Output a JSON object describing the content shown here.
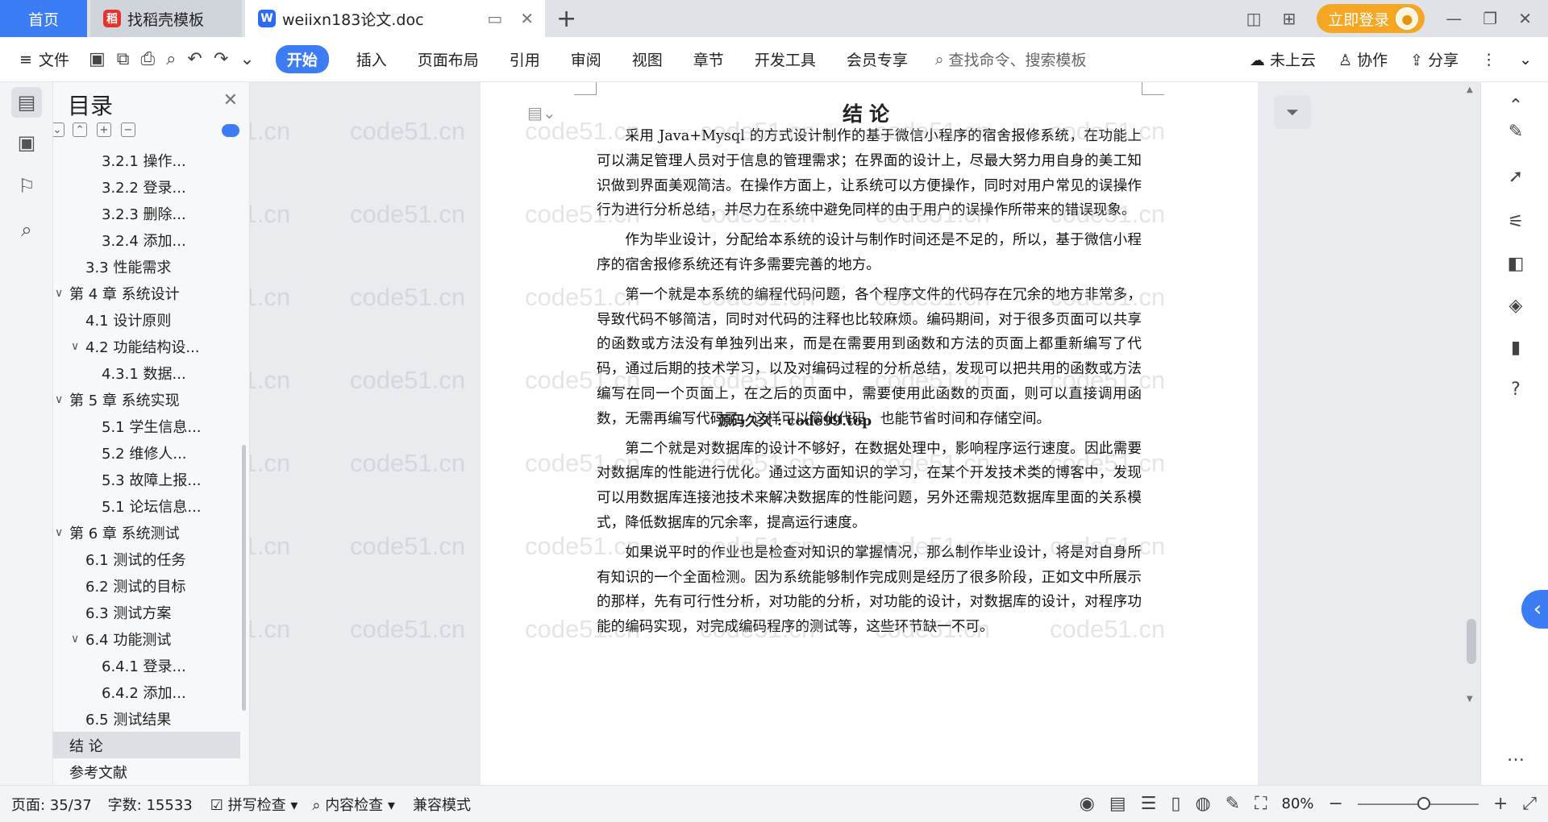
{
  "tabs": {
    "home": "首页",
    "template": "找稻壳模板",
    "doc": "weiixn183论文.doc",
    "new_tab": "+"
  },
  "window": {
    "login": "立即登录"
  },
  "toolbar": {
    "file": "文件",
    "items": [
      "开始",
      "插入",
      "页面布局",
      "引用",
      "审阅",
      "视图",
      "章节",
      "开发工具",
      "会员专享"
    ],
    "search": "查找命令、搜索模板",
    "cloud": "未上云",
    "collab": "协作",
    "share": "分享"
  },
  "toc": {
    "title": "目录",
    "items": [
      {
        "label": "3.2.1 操作...",
        "level": 3,
        "arrow": ""
      },
      {
        "label": "3.2.2 登录...",
        "level": 3,
        "arrow": ""
      },
      {
        "label": "3.2.3 删除...",
        "level": 3,
        "arrow": ""
      },
      {
        "label": "3.2.4 添加...",
        "level": 3,
        "arrow": ""
      },
      {
        "label": "3.3 性能需求",
        "level": 2,
        "arrow": ""
      },
      {
        "label": "第 4 章 系统设计",
        "level": 1,
        "arrow": "∨"
      },
      {
        "label": "4.1 设计原则",
        "level": 2,
        "arrow": ""
      },
      {
        "label": "4.2 功能结构设...",
        "level": 2,
        "arrow": "∨"
      },
      {
        "label": "4.3.1 数据...",
        "level": 3,
        "arrow": ""
      },
      {
        "label": "第 5 章 系统实现",
        "level": 1,
        "arrow": "∨"
      },
      {
        "label": "5.1 学生信息...",
        "level": 3,
        "arrow": ""
      },
      {
        "label": "5.2 维修人...",
        "level": 3,
        "arrow": ""
      },
      {
        "label": "5.3 故障上报...",
        "level": 3,
        "arrow": ""
      },
      {
        "label": "5.1 论坛信息...",
        "level": 3,
        "arrow": ""
      },
      {
        "label": "第 6 章 系统测试",
        "level": 1,
        "arrow": "∨"
      },
      {
        "label": "6.1 测试的任务",
        "level": 2,
        "arrow": ""
      },
      {
        "label": "6.2 测试的目标",
        "level": 2,
        "arrow": ""
      },
      {
        "label": "6.3 测试方案",
        "level": 2,
        "arrow": ""
      },
      {
        "label": "6.4 功能测试",
        "level": 2,
        "arrow": "∨"
      },
      {
        "label": "6.4.1 登录...",
        "level": 3,
        "arrow": ""
      },
      {
        "label": "6.4.2 添加...",
        "level": 3,
        "arrow": ""
      },
      {
        "label": "6.5 测试结果",
        "level": 2,
        "arrow": ""
      },
      {
        "label": "结 论",
        "level": 1,
        "arrow": "",
        "selected": true
      },
      {
        "label": "参考文献",
        "level": 1,
        "arrow": ""
      }
    ]
  },
  "document": {
    "heading": "结论",
    "paragraphs": [
      "采用 Java+Mysql 的方式设计制作的基于微信小程序的宿舍报修系统，在功能上可以满足管理人员对于信息的管理需求；在界面的设计上，尽最大努力用自身的美工知识做到界面美观简洁。在操作方面上，让系统可以方便操作，同时对用户常见的误操作行为进行分析总结，并尽力在系统中避免同样的由于用户的误操作所带来的错误现象。",
      "作为毕业设计，分配给本系统的设计与制作时间还是不足的，所以，基于微信小程序的宿舍报修系统还有许多需要完善的地方。",
      "第一个就是本系统的编程代码问题，各个程序文件的代码存在冗余的地方非常多，导致代码不够简洁，同时对代码的注释也比较麻烦。编码期间，对于很多页面可以共享的函数或方法没有单独列出来，而是在需要用到函数和方法的页面上都重新编写了代码，通过后期的技术学习，以及对编码过程的分析总结，发现可以把共用的函数或方法编写在同一个页面上，在之后的页面中，需要使用此函数的页面，则可以直接调用函数，无需再编写代码了，这样可以简化代码，也能节省时间和存储空间。",
      "第二个就是对数据库的设计不够好，在数据处理中，影响程序运行速度。因此需要对数据库的性能进行优化。通过这方面知识的学习，在某个开发技术类的博客中，发现可以用数据库连接池技术来解决数据库的性能问题，另外还需规范数据库里面的关系模式，降低数据库的冗余率，提高运行速度。",
      "如果说平时的作业也是检查对知识的掌握情况，那么制作毕业设计，将是对自身所有知识的一个全面检测。因为系统能够制作完成则是经历了很多阶段，正如文中所展示的那样，先有可行性分析，对功能的分析，对功能的设计，对数据库的设计，对程序功能的编码实现，对完成编码程序的测试等，这些环节缺一不可。"
    ],
    "overlay_text": "源码久久 : code99.top",
    "watermark": "code51.cn"
  },
  "status": {
    "page": "页面: 35/37",
    "words": "字数: 15533",
    "spell": "拼写检查",
    "content_check": "内容检查",
    "compat": "兼容模式",
    "zoom": "80%"
  }
}
